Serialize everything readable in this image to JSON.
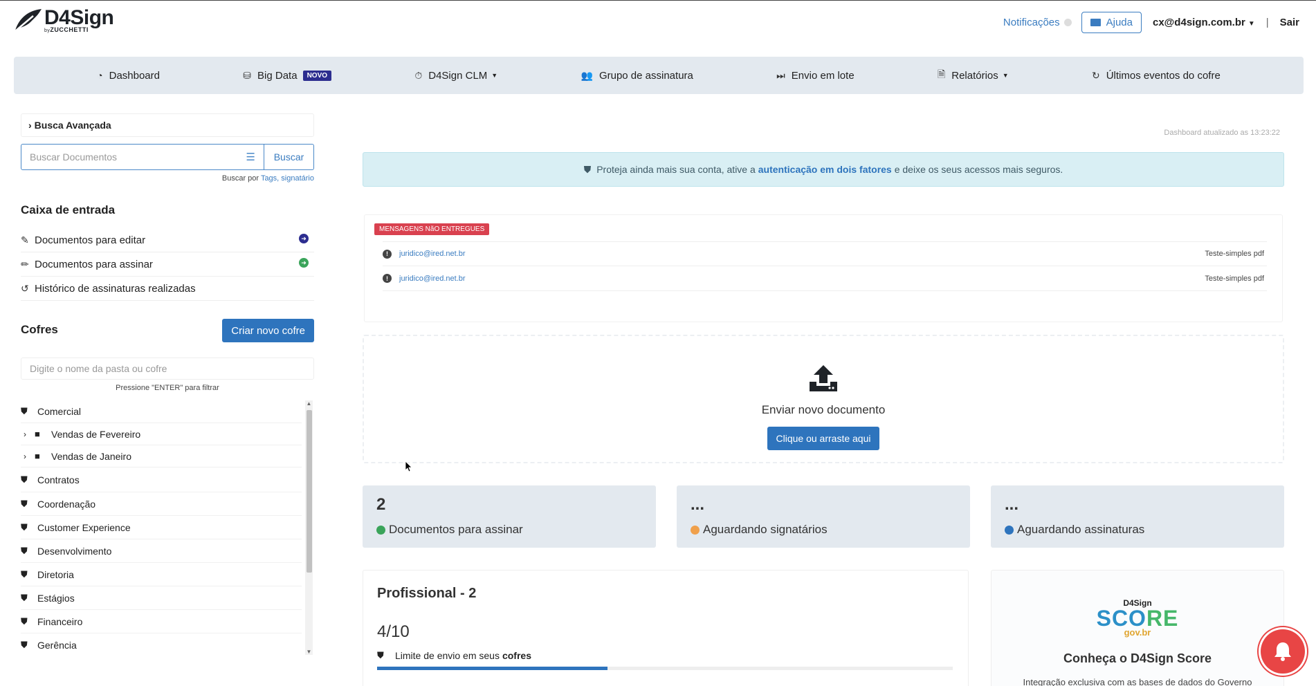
{
  "header": {
    "logo_name": "D4Sign",
    "logo_by": "by",
    "logo_company": "ZUCCHETTI",
    "notifications_label": "Notificações",
    "help_label": "Ajuda",
    "user_email": "cx@d4sign.com.br",
    "separator": "|",
    "logout_label": "Sair"
  },
  "nav": {
    "items": [
      {
        "label": "Dashboard",
        "icon": "dashboard-icon"
      },
      {
        "label": "Big Data",
        "icon": "database-icon",
        "badge": "NOVO"
      },
      {
        "label": "D4Sign CLM",
        "icon": "stopwatch-icon",
        "dropdown": true
      },
      {
        "label": "Grupo de assinatura",
        "icon": "users-icon"
      },
      {
        "label": "Envio em lote",
        "icon": "fast-forward-icon"
      },
      {
        "label": "Relatórios",
        "icon": "file-icon",
        "dropdown": true
      },
      {
        "label": "Últimos eventos do cofre",
        "icon": "refresh-icon"
      }
    ]
  },
  "sidebar": {
    "advanced_search_label": "Busca Avançada",
    "search_placeholder": "Buscar Documentos",
    "search_button": "Buscar",
    "search_hint_prefix": "Buscar por",
    "search_hint_tags": "Tags,",
    "search_hint_signer": "signatário",
    "inbox_title": "Caixa de entrada",
    "inbox_items": [
      {
        "label": "Documentos para editar",
        "icon": "edit-icon",
        "indicator_color": "#2c2d8f"
      },
      {
        "label": "Documentos para assinar",
        "icon": "pencil-icon",
        "indicator_color": "#3aa45a"
      },
      {
        "label": "Histórico de assinaturas realizadas",
        "icon": "history-icon"
      }
    ],
    "vaults_title": "Cofres",
    "new_vault_button": "Criar novo cofre",
    "vault_filter_placeholder": "Digite o nome da pasta ou cofre",
    "vault_filter_hint": "Pressione \"ENTER\" para filtrar",
    "vaults": [
      {
        "label": "Comercial",
        "type": "vault"
      },
      {
        "label": "Vendas de Fevereiro",
        "type": "folder"
      },
      {
        "label": "Vendas de Janeiro",
        "type": "folder"
      },
      {
        "label": "Contratos",
        "type": "vault"
      },
      {
        "label": "Coordenação",
        "type": "vault"
      },
      {
        "label": "Customer Experience",
        "type": "vault"
      },
      {
        "label": "Desenvolvimento",
        "type": "vault"
      },
      {
        "label": "Diretoria",
        "type": "vault"
      },
      {
        "label": "Estágios",
        "type": "vault"
      },
      {
        "label": "Financeiro",
        "type": "vault"
      },
      {
        "label": "Gerência",
        "type": "vault"
      }
    ]
  },
  "main": {
    "updated_text": "Dashboard atualizado as 13:23:22",
    "alert": {
      "prefix": "Proteja ainda mais sua conta, ative a",
      "link": "autenticação em dois fatores",
      "suffix": "e deixe os seus acessos mais seguros."
    },
    "undelivered": {
      "badge": "MENSAGENS NãO ENTREGUES",
      "rows": [
        {
          "email": "juridico@ired.net.br",
          "file": "Teste-simples pdf"
        },
        {
          "email": "juridico@ired.net.br",
          "file": "Teste-simples pdf"
        }
      ]
    },
    "upload": {
      "title": "Enviar novo documento",
      "button": "Clique ou arraste aqui"
    },
    "stats": [
      {
        "value": "2",
        "label": "Documentos para assinar",
        "color": "#3aa45a"
      },
      {
        "value": "...",
        "label": "Aguardando signatários",
        "color": "#f0a04b"
      },
      {
        "value": "...",
        "label": "Aguardando assinaturas",
        "color": "#2e74bd"
      }
    ],
    "plan": {
      "title": "Profissional - 2",
      "count": "4/10",
      "limit_text": "Limite de envio em seus",
      "limit_bold": "cofres",
      "used": 4,
      "total": 10
    },
    "score": {
      "brand": "D4Sign",
      "word_a": "SCO",
      "word_b": "RE",
      "gov": "gov.br",
      "title": "Conheça o D4Sign Score",
      "subtitle": "Integração exclusiva com as bases de dados do Governo"
    }
  },
  "colors": {
    "primary": "#2e74bd",
    "link": "#3a7cc0",
    "nav_bg": "#e3e9ef",
    "danger": "#d9414f",
    "bell": "#e84545"
  }
}
